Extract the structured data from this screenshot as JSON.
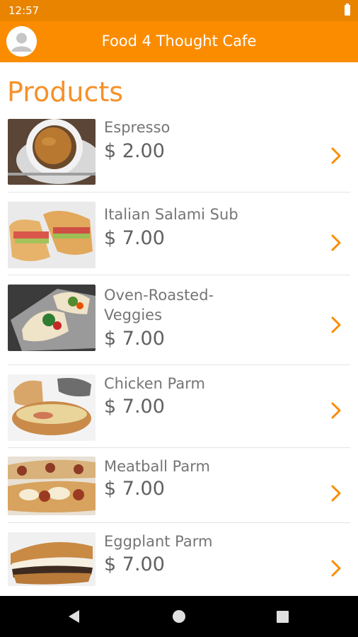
{
  "status_bar": {
    "time": "12:57"
  },
  "app_bar": {
    "title": "Food 4 Thought Cafe"
  },
  "page": {
    "heading": "Products"
  },
  "products": [
    {
      "name": "Espresso",
      "price": "$ 2.00"
    },
    {
      "name": "Italian Salami Sub",
      "price": "$ 7.00"
    },
    {
      "name": "Oven-Roasted-Veggies",
      "price": "$ 7.00"
    },
    {
      "name": "Chicken Parm",
      "price": "$ 7.00"
    },
    {
      "name": "Meatball Parm",
      "price": "$ 7.00"
    },
    {
      "name": "Eggplant Parm",
      "price": "$ 7.00"
    }
  ],
  "icons": {
    "avatar": "user-avatar-icon",
    "chevron": "chevron-right-icon",
    "nav": [
      "back-icon",
      "home-icon",
      "recents-icon"
    ]
  },
  "colors": {
    "accent": "#fb8c00",
    "status_bar": "#e88400",
    "heading": "#f5912a"
  }
}
